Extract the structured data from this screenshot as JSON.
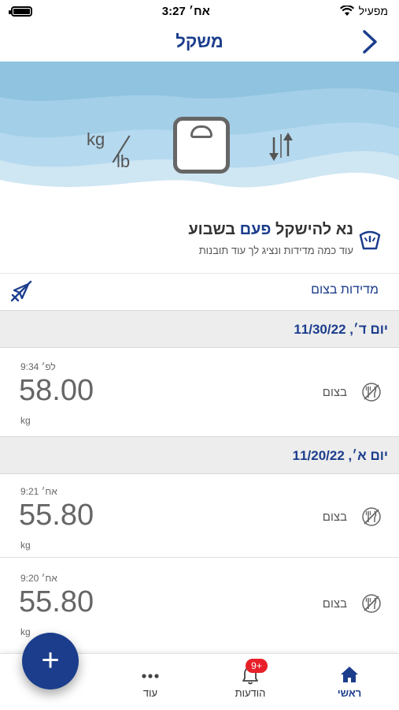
{
  "status_bar": {
    "time": "3:27 אח׳",
    "carrier": "מפעיל"
  },
  "header": {
    "title": "משקל"
  },
  "hero": {
    "unit_kg": "kg",
    "unit_lb": "lb"
  },
  "reminder": {
    "title_prefix": "נא להישקל",
    "title_accent": "פעם",
    "title_suffix": "בשבוע",
    "subtitle": "עוד כמה מדידות ונציג לך עוד תובנות"
  },
  "filter": {
    "label": "מדידות בצום"
  },
  "groups": [
    {
      "date": "יום ד׳, 11/30/22",
      "entries": [
        {
          "time": "9:34 לפ׳",
          "value": "58.00",
          "unit": "kg",
          "status": "בצום"
        }
      ]
    },
    {
      "date": "יום א׳, 11/20/22",
      "entries": [
        {
          "time": "9:21 אח׳",
          "value": "55.80",
          "unit": "kg",
          "status": "בצום"
        },
        {
          "time": "9:20 אח׳",
          "value": "55.80",
          "unit": "kg",
          "status": "בצום"
        }
      ]
    }
  ],
  "tab_bar": {
    "home": "ראשי",
    "notifications": "הודעות",
    "notifications_badge": "9+",
    "more": "עוד"
  },
  "fab": {
    "label": "+"
  },
  "colors": {
    "brand_blue": "#1b3d8c",
    "badge_red": "#e8202a",
    "date_header_bg": "#ededed"
  },
  "icons": {
    "header_back": "chevron-right-icon",
    "reminder": "scale-icon",
    "filter": "no-food-icon",
    "entry_status": "fork-knife-off-icon",
    "tab_home": "home-icon",
    "tab_notifications": "bell-icon",
    "tab_more": "dots-icon"
  }
}
